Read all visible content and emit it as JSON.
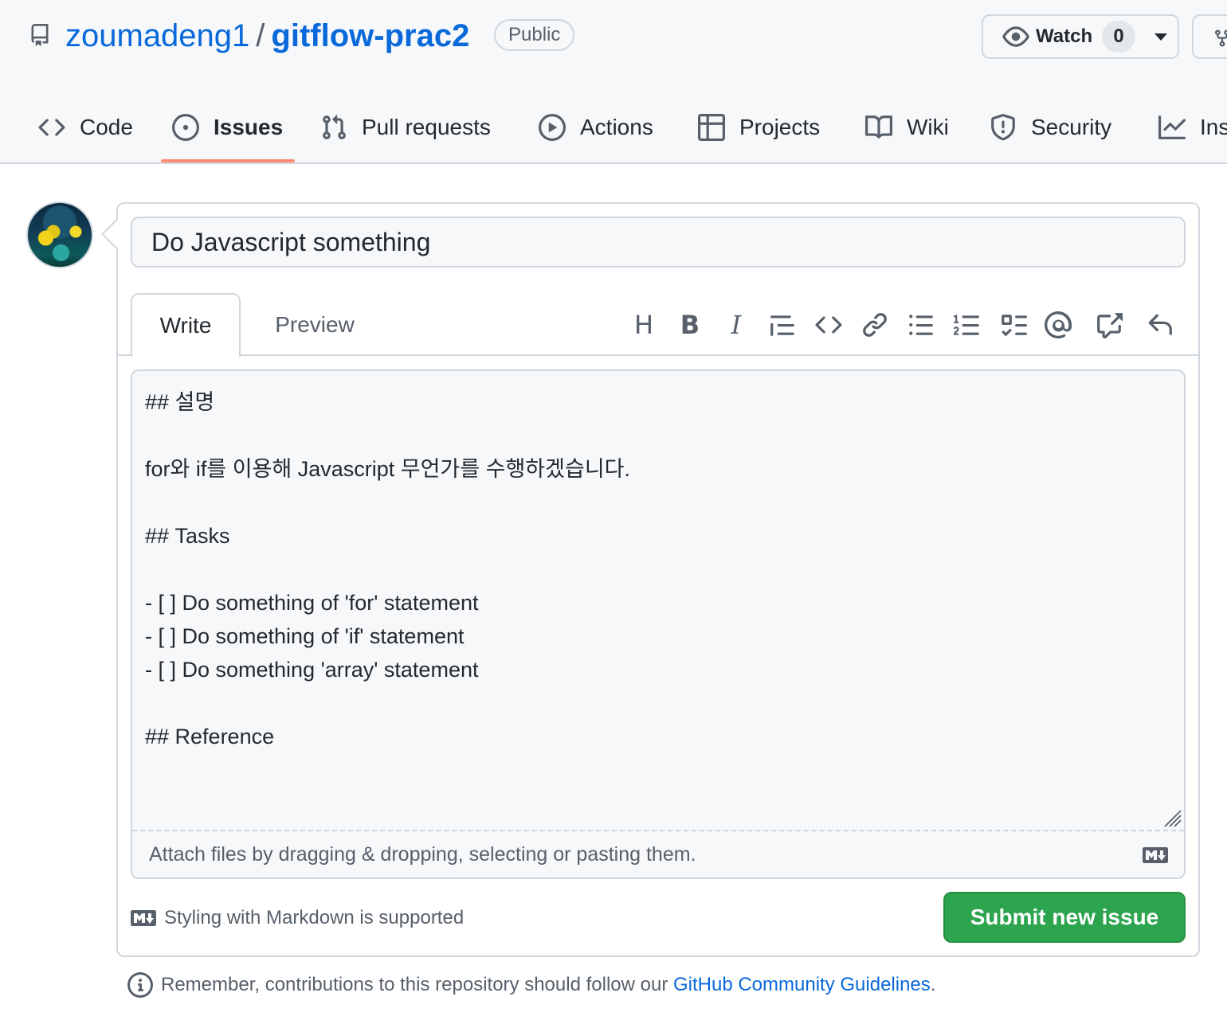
{
  "repo": {
    "owner": "zoumadeng1",
    "separator": "/",
    "name": "gitflow-prac2",
    "visibility": "Public"
  },
  "watch": {
    "label": "Watch",
    "count": "0"
  },
  "tabs": [
    {
      "label": "Code",
      "icon": "code-icon"
    },
    {
      "label": "Issues",
      "icon": "issue-opened-icon",
      "selected": true
    },
    {
      "label": "Pull requests",
      "icon": "git-pull-request-icon"
    },
    {
      "label": "Actions",
      "icon": "play-icon"
    },
    {
      "label": "Projects",
      "icon": "table-icon"
    },
    {
      "label": "Wiki",
      "icon": "book-icon"
    },
    {
      "label": "Security",
      "icon": "shield-icon"
    },
    {
      "label": "Ins",
      "icon": "graph-icon"
    }
  ],
  "issue": {
    "title": "Do Javascript something",
    "body": "## 설명\n\nfor와 if를 이용해 Javascript 무언가를 수행하겠습니다.\n\n## Tasks\n\n- [ ] Do something of 'for' statement\n- [ ] Do something of 'if' statement\n- [ ] Do something 'array' statement\n\n## Reference"
  },
  "editor": {
    "write_tab": "Write",
    "preview_tab": "Preview",
    "toolbar": {
      "heading": "H",
      "bold": "B",
      "italic": "I"
    },
    "attach_hint": "Attach files by dragging & dropping, selecting or pasting them."
  },
  "footer": {
    "markdown_note": "Styling with Markdown is supported",
    "submit_label": "Submit new issue",
    "guidelines_prefix": "Remember, contributions to this repository should follow our",
    "guidelines_link": "GitHub Community Guidelines",
    "guidelines_suffix": "."
  },
  "colors": {
    "link": "#0969da",
    "primary_button": "#2da44e",
    "selected_tab_underline": "#fd8c73",
    "border": "#d0d7de"
  }
}
